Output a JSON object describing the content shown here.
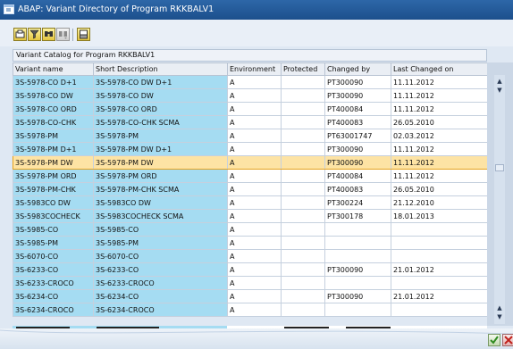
{
  "window": {
    "title": "ABAP: Variant Directory of Program RKKBALV1"
  },
  "toolbar": {
    "buttons": [
      {
        "icon": "details-icon",
        "label": ""
      },
      {
        "icon": "filter-icon",
        "label": ""
      },
      {
        "icon": "find-icon",
        "label": ""
      },
      {
        "icon": "find-next-icon",
        "label": ""
      },
      {
        "icon": "print-icon",
        "label": ""
      }
    ]
  },
  "catalog": {
    "caption": "Variant Catalog for Program RKKBALV1"
  },
  "table": {
    "columns": [
      "Variant name",
      "Short Description",
      "Environment",
      "Protected",
      "Changed by",
      "Last Changed on"
    ],
    "rows": [
      [
        "3S-5978-CO D+1",
        "3S-5978-CO DW D+1",
        "A",
        "",
        "PT300090",
        "11.11.2012"
      ],
      [
        "3S-5978-CO DW",
        "3S-5978-CO DW",
        "A",
        "",
        "PT300090",
        "11.11.2012"
      ],
      [
        "3S-5978-CO ORD",
        "3S-5978-CO ORD",
        "A",
        "",
        "PT400084",
        "11.11.2012"
      ],
      [
        "3S-5978-CO-CHK",
        "3S-5978-CO-CHK SCMA",
        "A",
        "",
        "PT400083",
        "26.05.2010"
      ],
      [
        "3S-5978-PM",
        "3S-5978-PM",
        "A",
        "",
        "PT63001747",
        "02.03.2012"
      ],
      [
        "3S-5978-PM D+1",
        "3S-5978-PM DW D+1",
        "A",
        "",
        "PT300090",
        "11.11.2012"
      ],
      [
        "3S-5978-PM DW",
        "3S-5978-PM DW",
        "A",
        "",
        "PT300090",
        "11.11.2012"
      ],
      [
        "3S-5978-PM ORD",
        "3S-5978-PM ORD",
        "A",
        "",
        "PT400084",
        "11.11.2012"
      ],
      [
        "3S-5978-PM-CHK",
        "3S-5978-PM-CHK SCMA",
        "A",
        "",
        "PT400083",
        "26.05.2010"
      ],
      [
        "3S-5983CO DW",
        "3S-5983CO DW",
        "A",
        "",
        "PT300224",
        "21.12.2010"
      ],
      [
        "3S-5983COCHECK",
        "3S-5983COCHECK SCMA",
        "A",
        "",
        "PT300178",
        "18.01.2013"
      ],
      [
        "3S-5985-CO",
        "3S-5985-CO",
        "A",
        "",
        "",
        ""
      ],
      [
        "3S-5985-PM",
        "3S-5985-PM",
        "A",
        "",
        "",
        ""
      ],
      [
        "3S-6070-CO",
        "3S-6070-CO",
        "A",
        "",
        "",
        ""
      ],
      [
        "3S-6233-CO",
        "3S-6233-CO",
        "A",
        "",
        "PT300090",
        "21.01.2012"
      ],
      [
        "3S-6233-CROCO",
        "3S-6233-CROCO",
        "A",
        "",
        "",
        ""
      ],
      [
        "3S-6234-CO",
        "3S-6234-CO",
        "A",
        "",
        "PT300090",
        "21.01.2012"
      ],
      [
        "3S-6234-CROCO",
        "3S-6234-CROCO",
        "A",
        "",
        "",
        ""
      ]
    ],
    "selected_row": 6
  },
  "footer": {
    "ok_icon": "checkmark-icon",
    "cancel_icon": "cancel-icon"
  },
  "colors": {
    "titlebar": "#1c4f8c",
    "key_column": "#a5dcf2",
    "selected_row": "#fde3a4",
    "selected_border": "#e5a21e"
  }
}
